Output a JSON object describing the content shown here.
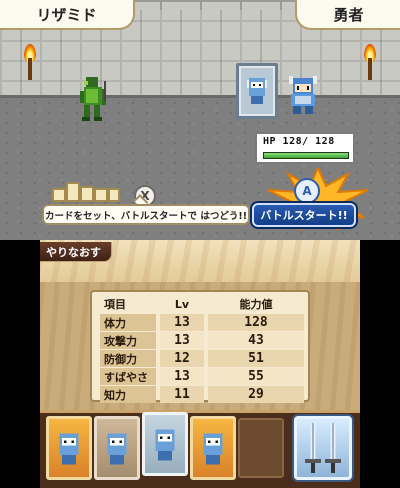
{
  "top_screen": {
    "enemy_name": "リザミド",
    "hero_name": "勇者",
    "hp": {
      "label": "HP",
      "current": 128,
      "max": 128,
      "text": "HP 128/ 128",
      "fill_fraction": 1.0
    },
    "hint": "カードをセット、バトルスタートで はつどう!!",
    "x_button": "X",
    "a_button": "A",
    "battle_start_label": "バトルスタート!!"
  },
  "bottom_screen": {
    "redo_label": "やりなおす",
    "table_headers": {
      "item": "項目",
      "level": "Lv",
      "value": "能力値"
    },
    "stats": [
      {
        "name": "体力",
        "lv": "13",
        "value": "128"
      },
      {
        "name": "攻撃力",
        "lv": "13",
        "value": "43"
      },
      {
        "name": "防御力",
        "lv": "12",
        "value": "51"
      },
      {
        "name": "すばやさ",
        "lv": "13",
        "value": "55"
      },
      {
        "name": "知力",
        "lv": "11",
        "value": "29"
      }
    ],
    "hand_cards": [
      "gold-shield-card",
      "brown-shield-card",
      "steel-shield-card",
      "gold-shield-card"
    ],
    "weapon_card": "twin-swords-card"
  },
  "colors": {
    "hp_bar": "#3fa338",
    "battle_button": "#123e86",
    "panel": "#c9ac7c"
  }
}
